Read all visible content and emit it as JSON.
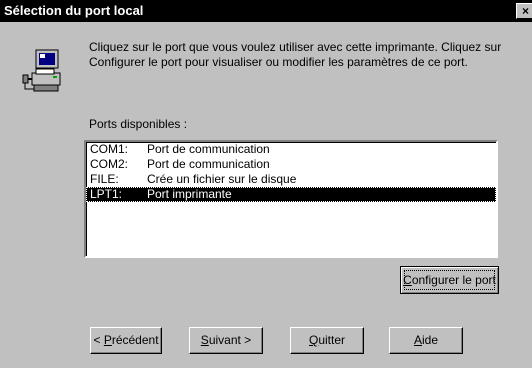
{
  "window": {
    "title": "Sélection du port local",
    "close_glyph": "×"
  },
  "icon": "printer-port-icon",
  "intro": {
    "text": "Cliquez sur le port que vous voulez utiliser avec cette imprimante. Cliquez sur Configurer le port pour visualiser ou modifier les paramètres de ce port."
  },
  "ports": {
    "label": "Ports disponibles :",
    "items": [
      {
        "name": "COM1:",
        "description": "Port de communication",
        "selected": false
      },
      {
        "name": "COM2:",
        "description": "Port de communication",
        "selected": false
      },
      {
        "name": "FILE:",
        "description": "Crée un fichier sur le disque",
        "selected": false
      },
      {
        "name": "LPT1:",
        "description": "Port imprimante",
        "selected": true
      }
    ]
  },
  "buttons": {
    "configure": {
      "mnemonic": "C",
      "rest": "onfigurer le port"
    },
    "back": {
      "prefix": "< ",
      "mnemonic": "P",
      "rest": "récédent"
    },
    "next": {
      "mnemonic": "S",
      "rest": "uivant >"
    },
    "quit": {
      "mnemonic": "Q",
      "rest": "uitter"
    },
    "help": {
      "mnemonic": "A",
      "rest": "ide"
    }
  },
  "colors": {
    "dialog_bg": "#c0c0c0",
    "title_bg": "#000000",
    "selection_bg": "#000000"
  }
}
